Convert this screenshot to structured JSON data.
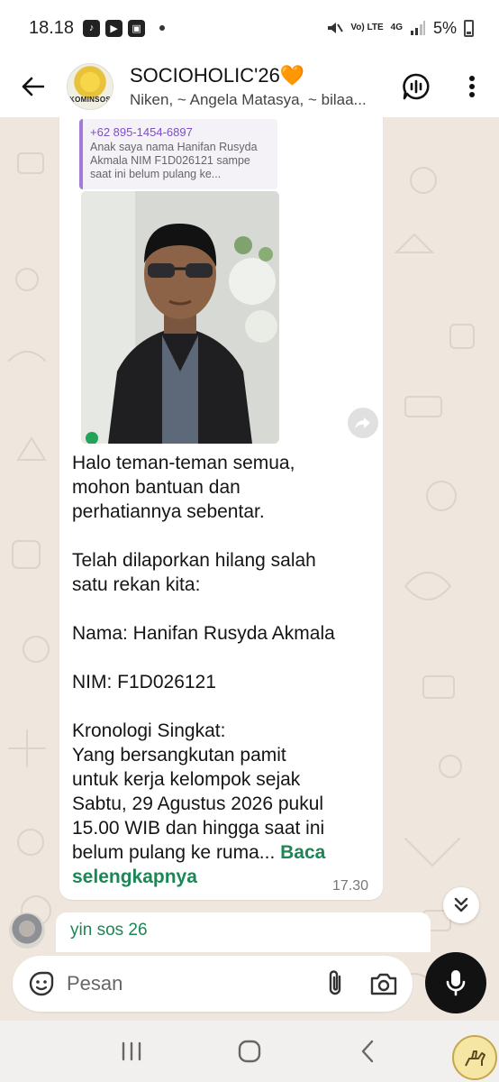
{
  "status_bar": {
    "time": "18.18",
    "network_label": "Vo) LTE",
    "network_type": "4G",
    "battery": "5%"
  },
  "header": {
    "title": "SOCIOHOLIC'26🧡",
    "subtitle": "Niken, ~ Angela Matasya, ~ bilaa...",
    "avatar_text": "KOMINSOS"
  },
  "message": {
    "quote_phone": "+62 895-1454-6897",
    "quote_text": "Anak saya nama Hanifan Rusyda Akmala  NIM F1D026121 sampe saat ini belum pulang ke...",
    "body": "Halo teman-teman semua,\nmohon bantuan dan\nperhatiannya sebentar.\n\nTelah dilaporkan hilang salah\nsatu rekan kita:\n\nNama: Hanifan Rusyda Akmala\n\nNIM: F1D026121\n\nKronologi Singkat:\nYang bersangkutan pamit\nuntuk kerja kelompok sejak\nSabtu, 29 Agustus 2026 pukul\n15.00 WIB dan hingga saat ini\nbelum pulang ke ruma... ",
    "read_more": "Baca selengkapnya",
    "time": "17.30"
  },
  "next_message": {
    "sender": "yin sos 26"
  },
  "composer": {
    "placeholder": "Pesan"
  },
  "colors": {
    "accent_green": "#1b8755",
    "quote_purple": "#7d4fc9"
  }
}
